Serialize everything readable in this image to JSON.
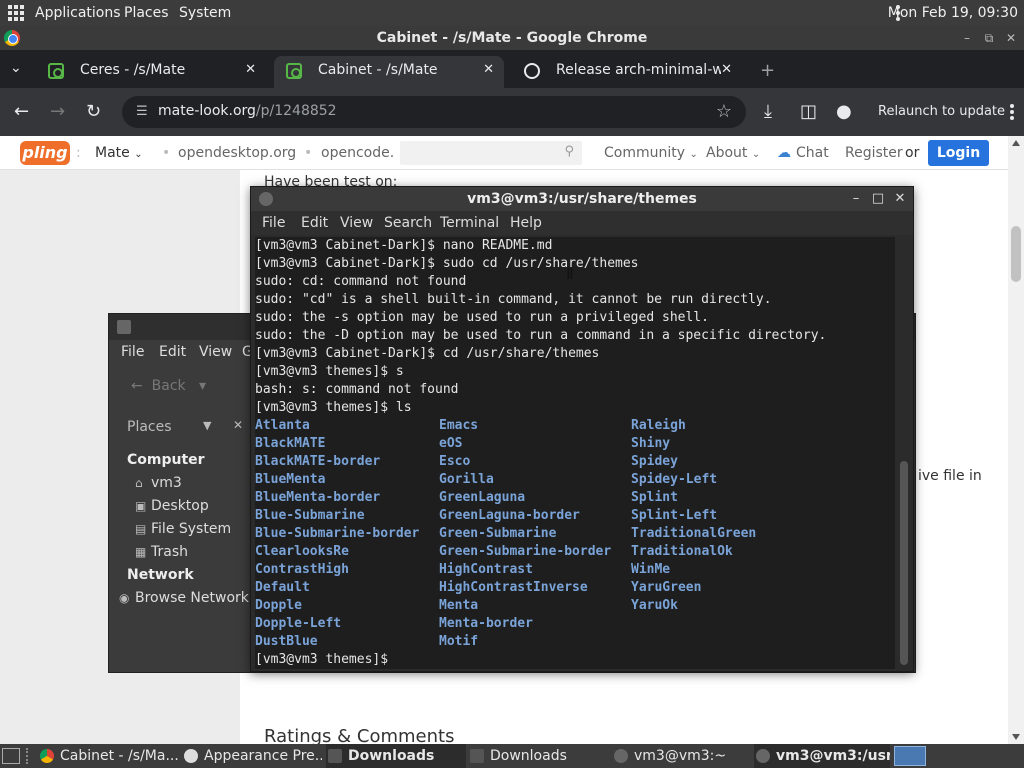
{
  "top_panel": {
    "menus": [
      "Applications",
      "Places",
      "System"
    ],
    "clock": "Mon Feb 19, 09:30"
  },
  "chrome": {
    "window_title": "Cabinet - /s/Mate - Google Chrome",
    "tabs": [
      {
        "title": "Ceres - /s/Mate",
        "icon": "pling-favicon"
      },
      {
        "title": "Cabinet - /s/Mate",
        "icon": "pling-favicon"
      },
      {
        "title": "Release arch-minimal-wallp",
        "icon": "github-icon"
      }
    ],
    "url_host": "mate-look.org",
    "url_path": "/p/1248852",
    "relaunch_label": "Relaunch to update"
  },
  "site": {
    "logo": "pling",
    "nav_mate": "Mate",
    "nav_opendesktop": "opendesktop.org",
    "nav_opencode": "opencode.",
    "nav_community": "Community",
    "nav_about": "About",
    "nav_chat": "Chat",
    "nav_register": "Register",
    "nav_or": "or",
    "login_label": "Login",
    "text_tested": "Have been test on:",
    "text_file": "ive file in",
    "ratings_heading": "Ratings & Comments"
  },
  "file_manager": {
    "menus": [
      "File",
      "Edit",
      "View",
      "G"
    ],
    "back_label": "Back",
    "places_label": "Places",
    "section_computer": "Computer",
    "items_computer": [
      {
        "label": "vm3",
        "icon": "home-icon"
      },
      {
        "label": "Desktop",
        "icon": "desktop-icon"
      },
      {
        "label": "File System",
        "icon": "drive-icon"
      },
      {
        "label": "Trash",
        "icon": "trash-icon"
      }
    ],
    "section_network": "Network",
    "items_network": [
      {
        "label": "Browse Network",
        "icon": "network-icon"
      }
    ]
  },
  "terminal": {
    "title": "vm3@vm3:/usr/share/themes",
    "menus": [
      "File",
      "Edit",
      "View",
      "Search",
      "Terminal",
      "Help"
    ],
    "lines": [
      "[vm3@vm3 Cabinet-Dark]$ nano README.md",
      "[vm3@vm3 Cabinet-Dark]$ sudo cd /usr/share/themes",
      "sudo: cd: command not found",
      "sudo: \"cd\" is a shell built-in command, it cannot be run directly.",
      "sudo: the -s option may be used to run a privileged shell.",
      "sudo: the -D option may be used to run a command in a specific directory.",
      "[vm3@vm3 Cabinet-Dark]$ cd /usr/share/themes",
      "[vm3@vm3 themes]$ s",
      "bash: s: command not found",
      "[vm3@vm3 themes]$ ls"
    ],
    "ls_columns": [
      [
        "Atlanta",
        "BlackMATE",
        "BlackMATE-border",
        "BlueMenta",
        "BlueMenta-border",
        "Blue-Submarine",
        "Blue-Submarine-border",
        "ClearlooksRe",
        "ContrastHigh",
        "Default",
        "Dopple",
        "Dopple-Left",
        "DustBlue"
      ],
      [
        "Emacs",
        "eOS",
        "Esco",
        "Gorilla",
        "GreenLaguna",
        "GreenLaguna-border",
        "Green-Submarine",
        "Green-Submarine-border",
        "HighContrast",
        "HighContrastInverse",
        "Menta",
        "Menta-border",
        "Motif"
      ],
      [
        "Raleigh",
        "Shiny",
        "Spidey",
        "Spidey-Left",
        "Splint",
        "Splint-Left",
        "TraditionalGreen",
        "TraditionalOk",
        "WinMe",
        "YaruGreen",
        "YaruOk"
      ]
    ],
    "prompt": "[vm3@vm3 themes]$ ",
    "dir_color": "#7aa3d8"
  },
  "taskbar": {
    "tasks": [
      {
        "label": "Cabinet - /s/Ma...",
        "icon": "chrome-icon"
      },
      {
        "label": "Appearance Pre...",
        "icon": "appearance-icon"
      },
      {
        "label": "Downloads",
        "icon": "folder-icon"
      },
      {
        "label": "Downloads",
        "icon": "folder-icon"
      },
      {
        "label": "vm3@vm3:~",
        "icon": "terminal-icon"
      },
      {
        "label": "vm3@vm3:/usr/...",
        "icon": "terminal-icon"
      }
    ]
  }
}
